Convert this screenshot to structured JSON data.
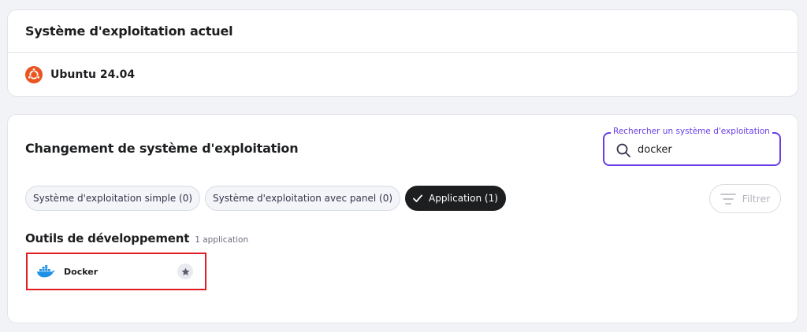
{
  "current_os": {
    "title": "Système d'exploitation actuel",
    "os_name": "Ubuntu 24.04",
    "icon": "ubuntu-icon"
  },
  "change_os": {
    "title": "Changement de système d'exploitation",
    "search": {
      "label": "Rechercher un système d'exploitation",
      "value": "docker",
      "icon": "search-icon"
    },
    "chips": [
      {
        "label": "Système d'exploitation simple (0)",
        "active": false
      },
      {
        "label": "Système d'exploitation avec panel (0)",
        "active": false
      },
      {
        "label": "Application (1)",
        "active": true
      }
    ],
    "filter_label": "Filtrer",
    "section": {
      "title": "Outils de développement",
      "count": "1 application"
    },
    "apps": [
      {
        "name": "Docker",
        "icon": "docker-icon",
        "action_icon": "star-icon"
      }
    ]
  },
  "colors": {
    "accent": "#673de6",
    "highlight_border": "#e31b23",
    "ubuntu": "#e95420",
    "docker": "#1d91e6",
    "active_chip": "#1d1e20"
  }
}
